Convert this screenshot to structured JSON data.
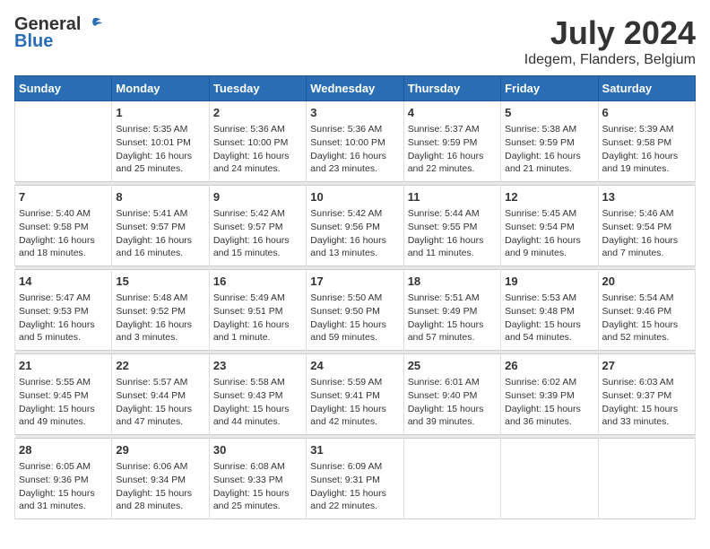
{
  "logo": {
    "general": "General",
    "blue": "Blue"
  },
  "title": {
    "month": "July 2024",
    "location": "Idegem, Flanders, Belgium"
  },
  "days_of_week": [
    "Sunday",
    "Monday",
    "Tuesday",
    "Wednesday",
    "Thursday",
    "Friday",
    "Saturday"
  ],
  "weeks": [
    {
      "days": [
        {
          "num": "",
          "sunrise": "",
          "sunset": "",
          "daylight": ""
        },
        {
          "num": "1",
          "sunrise": "Sunrise: 5:35 AM",
          "sunset": "Sunset: 10:01 PM",
          "daylight": "Daylight: 16 hours and 25 minutes."
        },
        {
          "num": "2",
          "sunrise": "Sunrise: 5:36 AM",
          "sunset": "Sunset: 10:00 PM",
          "daylight": "Daylight: 16 hours and 24 minutes."
        },
        {
          "num": "3",
          "sunrise": "Sunrise: 5:36 AM",
          "sunset": "Sunset: 10:00 PM",
          "daylight": "Daylight: 16 hours and 23 minutes."
        },
        {
          "num": "4",
          "sunrise": "Sunrise: 5:37 AM",
          "sunset": "Sunset: 9:59 PM",
          "daylight": "Daylight: 16 hours and 22 minutes."
        },
        {
          "num": "5",
          "sunrise": "Sunrise: 5:38 AM",
          "sunset": "Sunset: 9:59 PM",
          "daylight": "Daylight: 16 hours and 21 minutes."
        },
        {
          "num": "6",
          "sunrise": "Sunrise: 5:39 AM",
          "sunset": "Sunset: 9:58 PM",
          "daylight": "Daylight: 16 hours and 19 minutes."
        }
      ]
    },
    {
      "days": [
        {
          "num": "7",
          "sunrise": "Sunrise: 5:40 AM",
          "sunset": "Sunset: 9:58 PM",
          "daylight": "Daylight: 16 hours and 18 minutes."
        },
        {
          "num": "8",
          "sunrise": "Sunrise: 5:41 AM",
          "sunset": "Sunset: 9:57 PM",
          "daylight": "Daylight: 16 hours and 16 minutes."
        },
        {
          "num": "9",
          "sunrise": "Sunrise: 5:42 AM",
          "sunset": "Sunset: 9:57 PM",
          "daylight": "Daylight: 16 hours and 15 minutes."
        },
        {
          "num": "10",
          "sunrise": "Sunrise: 5:42 AM",
          "sunset": "Sunset: 9:56 PM",
          "daylight": "Daylight: 16 hours and 13 minutes."
        },
        {
          "num": "11",
          "sunrise": "Sunrise: 5:44 AM",
          "sunset": "Sunset: 9:55 PM",
          "daylight": "Daylight: 16 hours and 11 minutes."
        },
        {
          "num": "12",
          "sunrise": "Sunrise: 5:45 AM",
          "sunset": "Sunset: 9:54 PM",
          "daylight": "Daylight: 16 hours and 9 minutes."
        },
        {
          "num": "13",
          "sunrise": "Sunrise: 5:46 AM",
          "sunset": "Sunset: 9:54 PM",
          "daylight": "Daylight: 16 hours and 7 minutes."
        }
      ]
    },
    {
      "days": [
        {
          "num": "14",
          "sunrise": "Sunrise: 5:47 AM",
          "sunset": "Sunset: 9:53 PM",
          "daylight": "Daylight: 16 hours and 5 minutes."
        },
        {
          "num": "15",
          "sunrise": "Sunrise: 5:48 AM",
          "sunset": "Sunset: 9:52 PM",
          "daylight": "Daylight: 16 hours and 3 minutes."
        },
        {
          "num": "16",
          "sunrise": "Sunrise: 5:49 AM",
          "sunset": "Sunset: 9:51 PM",
          "daylight": "Daylight: 16 hours and 1 minute."
        },
        {
          "num": "17",
          "sunrise": "Sunrise: 5:50 AM",
          "sunset": "Sunset: 9:50 PM",
          "daylight": "Daylight: 15 hours and 59 minutes."
        },
        {
          "num": "18",
          "sunrise": "Sunrise: 5:51 AM",
          "sunset": "Sunset: 9:49 PM",
          "daylight": "Daylight: 15 hours and 57 minutes."
        },
        {
          "num": "19",
          "sunrise": "Sunrise: 5:53 AM",
          "sunset": "Sunset: 9:48 PM",
          "daylight": "Daylight: 15 hours and 54 minutes."
        },
        {
          "num": "20",
          "sunrise": "Sunrise: 5:54 AM",
          "sunset": "Sunset: 9:46 PM",
          "daylight": "Daylight: 15 hours and 52 minutes."
        }
      ]
    },
    {
      "days": [
        {
          "num": "21",
          "sunrise": "Sunrise: 5:55 AM",
          "sunset": "Sunset: 9:45 PM",
          "daylight": "Daylight: 15 hours and 49 minutes."
        },
        {
          "num": "22",
          "sunrise": "Sunrise: 5:57 AM",
          "sunset": "Sunset: 9:44 PM",
          "daylight": "Daylight: 15 hours and 47 minutes."
        },
        {
          "num": "23",
          "sunrise": "Sunrise: 5:58 AM",
          "sunset": "Sunset: 9:43 PM",
          "daylight": "Daylight: 15 hours and 44 minutes."
        },
        {
          "num": "24",
          "sunrise": "Sunrise: 5:59 AM",
          "sunset": "Sunset: 9:41 PM",
          "daylight": "Daylight: 15 hours and 42 minutes."
        },
        {
          "num": "25",
          "sunrise": "Sunrise: 6:01 AM",
          "sunset": "Sunset: 9:40 PM",
          "daylight": "Daylight: 15 hours and 39 minutes."
        },
        {
          "num": "26",
          "sunrise": "Sunrise: 6:02 AM",
          "sunset": "Sunset: 9:39 PM",
          "daylight": "Daylight: 15 hours and 36 minutes."
        },
        {
          "num": "27",
          "sunrise": "Sunrise: 6:03 AM",
          "sunset": "Sunset: 9:37 PM",
          "daylight": "Daylight: 15 hours and 33 minutes."
        }
      ]
    },
    {
      "days": [
        {
          "num": "28",
          "sunrise": "Sunrise: 6:05 AM",
          "sunset": "Sunset: 9:36 PM",
          "daylight": "Daylight: 15 hours and 31 minutes."
        },
        {
          "num": "29",
          "sunrise": "Sunrise: 6:06 AM",
          "sunset": "Sunset: 9:34 PM",
          "daylight": "Daylight: 15 hours and 28 minutes."
        },
        {
          "num": "30",
          "sunrise": "Sunrise: 6:08 AM",
          "sunset": "Sunset: 9:33 PM",
          "daylight": "Daylight: 15 hours and 25 minutes."
        },
        {
          "num": "31",
          "sunrise": "Sunrise: 6:09 AM",
          "sunset": "Sunset: 9:31 PM",
          "daylight": "Daylight: 15 hours and 22 minutes."
        },
        {
          "num": "",
          "sunrise": "",
          "sunset": "",
          "daylight": ""
        },
        {
          "num": "",
          "sunrise": "",
          "sunset": "",
          "daylight": ""
        },
        {
          "num": "",
          "sunrise": "",
          "sunset": "",
          "daylight": ""
        }
      ]
    }
  ]
}
